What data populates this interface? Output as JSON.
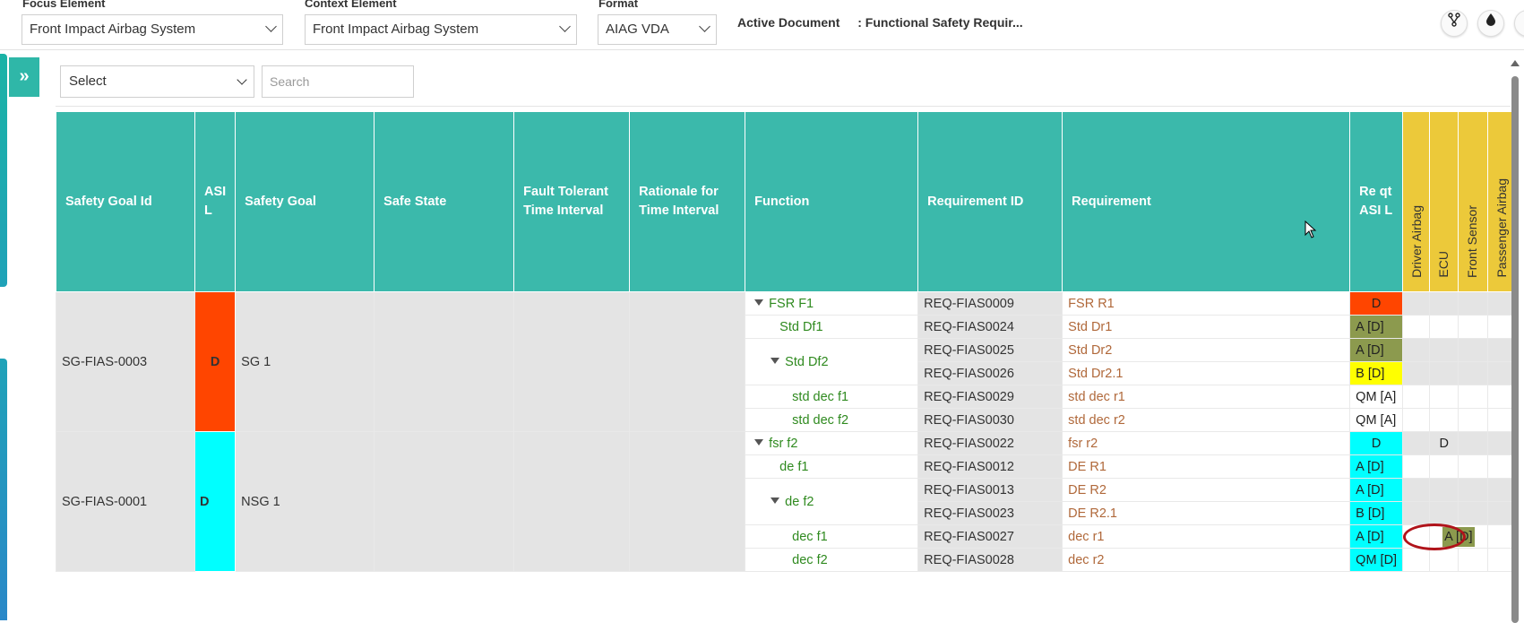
{
  "topbar": {
    "focus": {
      "label": "Focus Element",
      "value": "Front Impact Airbag System"
    },
    "context": {
      "label": "Context Element",
      "value": "Front Impact Airbag System"
    },
    "format": {
      "label": "Format",
      "value": "AIAG VDA"
    },
    "active_doc": {
      "label": "Active Document",
      "value": ": Functional Safety Requir..."
    }
  },
  "toolbar": {
    "filter_select": "Select",
    "search_placeholder": "Search"
  },
  "table": {
    "headers": {
      "sg_id": "Safety Goal Id",
      "asil": "ASI L",
      "sg": "Safety Goal",
      "safe_state": "Safe State",
      "ftti": "Fault Tolerant Time Interval",
      "rationale": "Rationale for Time Interval",
      "function": "Function",
      "req_id": "Requirement ID",
      "req": "Requirement",
      "req_asil": "Re qt ASI L",
      "alloc": [
        "Driver Airbag",
        "ECU",
        "Front Sensor",
        "Passenger Airbag"
      ]
    },
    "groups": [
      {
        "sg_id": "SG-FIAS-0003",
        "asil": "D",
        "sg": "SG 1"
      },
      {
        "sg_id": "SG-FIAS-0001",
        "asil": "D",
        "sg": "NSG 1"
      }
    ],
    "rows": [
      {
        "function": "FSR F1",
        "req_id": "REQ-FIAS0009",
        "req": "FSR R1",
        "req_asil": "D",
        "ecu": ""
      },
      {
        "function": "Std Df1",
        "req_id": "REQ-FIAS0024",
        "req": "Std Dr1",
        "req_asil": "A [D]",
        "ecu": ""
      },
      {
        "function": "Std Df2",
        "req_id": "REQ-FIAS0025",
        "req": "Std Dr2",
        "req_asil": "A [D]",
        "ecu": ""
      },
      {
        "function": "",
        "req_id": "REQ-FIAS0026",
        "req": "Std Dr2.1",
        "req_asil": "B [D]",
        "ecu": ""
      },
      {
        "function": "std dec f1",
        "req_id": "REQ-FIAS0029",
        "req": "std dec r1",
        "req_asil": "QM [A]",
        "ecu": ""
      },
      {
        "function": "std dec f2",
        "req_id": "REQ-FIAS0030",
        "req": "std dec r2",
        "req_asil": "QM [A]",
        "ecu": ""
      },
      {
        "function": "fsr f2",
        "req_id": "REQ-FIAS0022",
        "req": "fsr r2",
        "req_asil": "D",
        "ecu": "D"
      },
      {
        "function": "de f1",
        "req_id": "REQ-FIAS0012",
        "req": "DE R1",
        "req_asil": "A [D]",
        "ecu": ""
      },
      {
        "function": "de f2",
        "req_id": "REQ-FIAS0013",
        "req": "DE R2",
        "req_asil": "A [D]",
        "ecu": ""
      },
      {
        "function": "",
        "req_id": "REQ-FIAS0023",
        "req": "DE R2.1",
        "req_asil": "B [D]",
        "ecu": ""
      },
      {
        "function": "dec f1",
        "req_id": "REQ-FIAS0027",
        "req": "dec r1",
        "req_asil": "A [D]",
        "ecu": "A [D]"
      },
      {
        "function": "dec f2",
        "req_id": "REQ-FIAS0028",
        "req": "dec r2",
        "req_asil": "QM [D]",
        "ecu": ""
      }
    ]
  },
  "colors": {
    "teal": "#3bb9ab",
    "yellow": "#ecc93a",
    "asil_d_red": "#ff4500",
    "asil_cyan": "#00ffff",
    "olive": "#8c9a4e",
    "bright_yellow": "#ffff00",
    "annotation_red": "#b0131a"
  }
}
